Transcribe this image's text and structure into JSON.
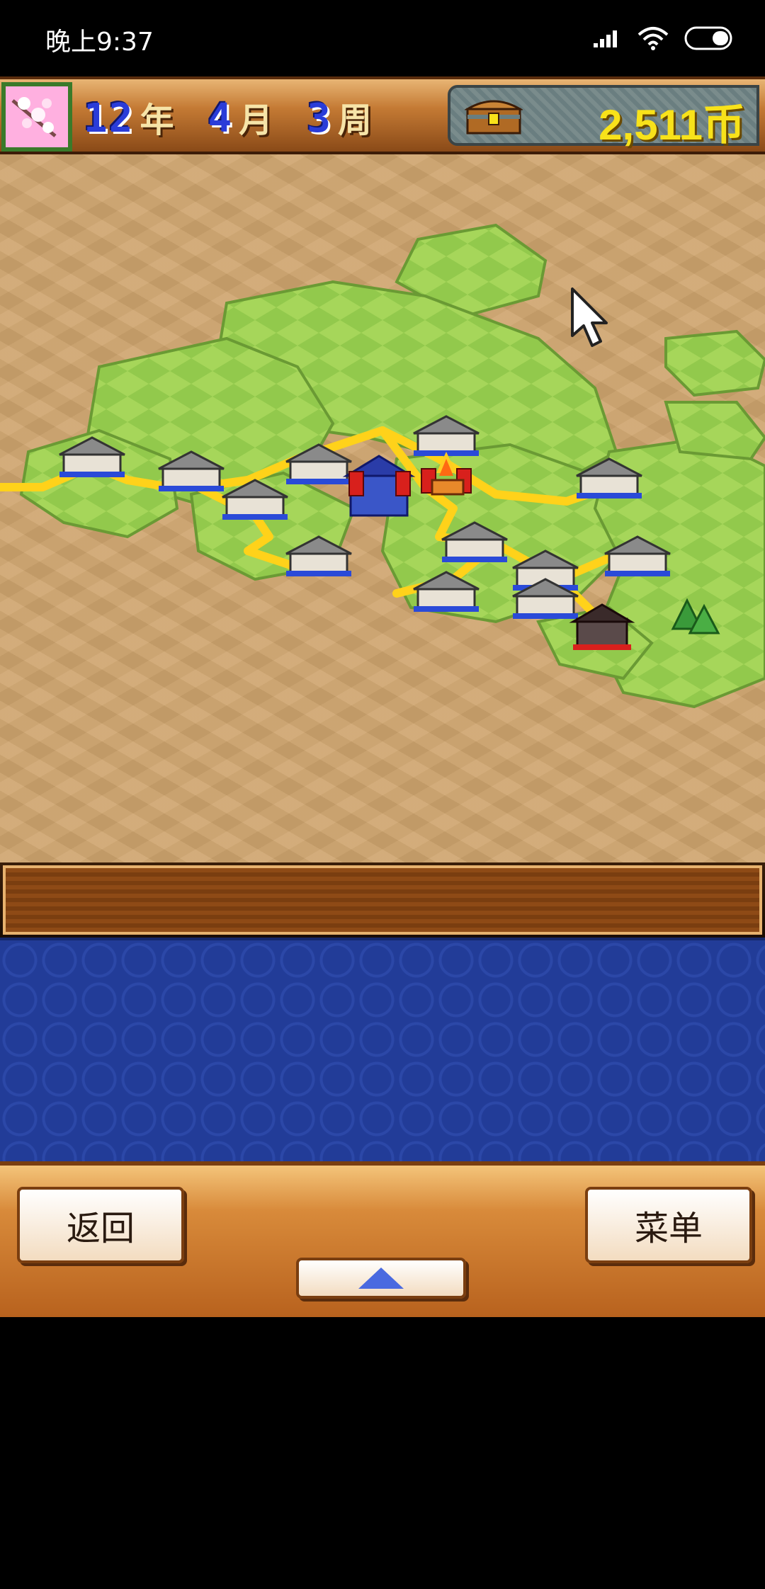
{
  "status_bar": {
    "time": "晚上9:37",
    "battery_icon": "battery-icon",
    "wifi_icon": "wifi-icon",
    "signal_icon": "signal-icon"
  },
  "header": {
    "season_icon": "cherry-blossom-icon",
    "year_value": "12",
    "year_unit": "年",
    "month_value": "4",
    "month_unit": "月",
    "week_value": "3",
    "week_unit": "周",
    "treasure_icon": "treasure-chest-icon",
    "money": "2,511币"
  },
  "map": {
    "cursor_icon": "pointer-cursor-icon"
  },
  "message_box": {
    "text": ""
  },
  "bottom_bar": {
    "back_label": "返回",
    "menu_label": "菜单",
    "expand_icon": "triangle-up-icon"
  },
  "colors": {
    "route_yellow": "#ffd21a",
    "grass_green": "#8fcf4a",
    "sand": "#cfa56e",
    "money_yellow": "#f8e21a",
    "date_blue": "#2a3cd8",
    "panel_blue": "#223c98"
  }
}
